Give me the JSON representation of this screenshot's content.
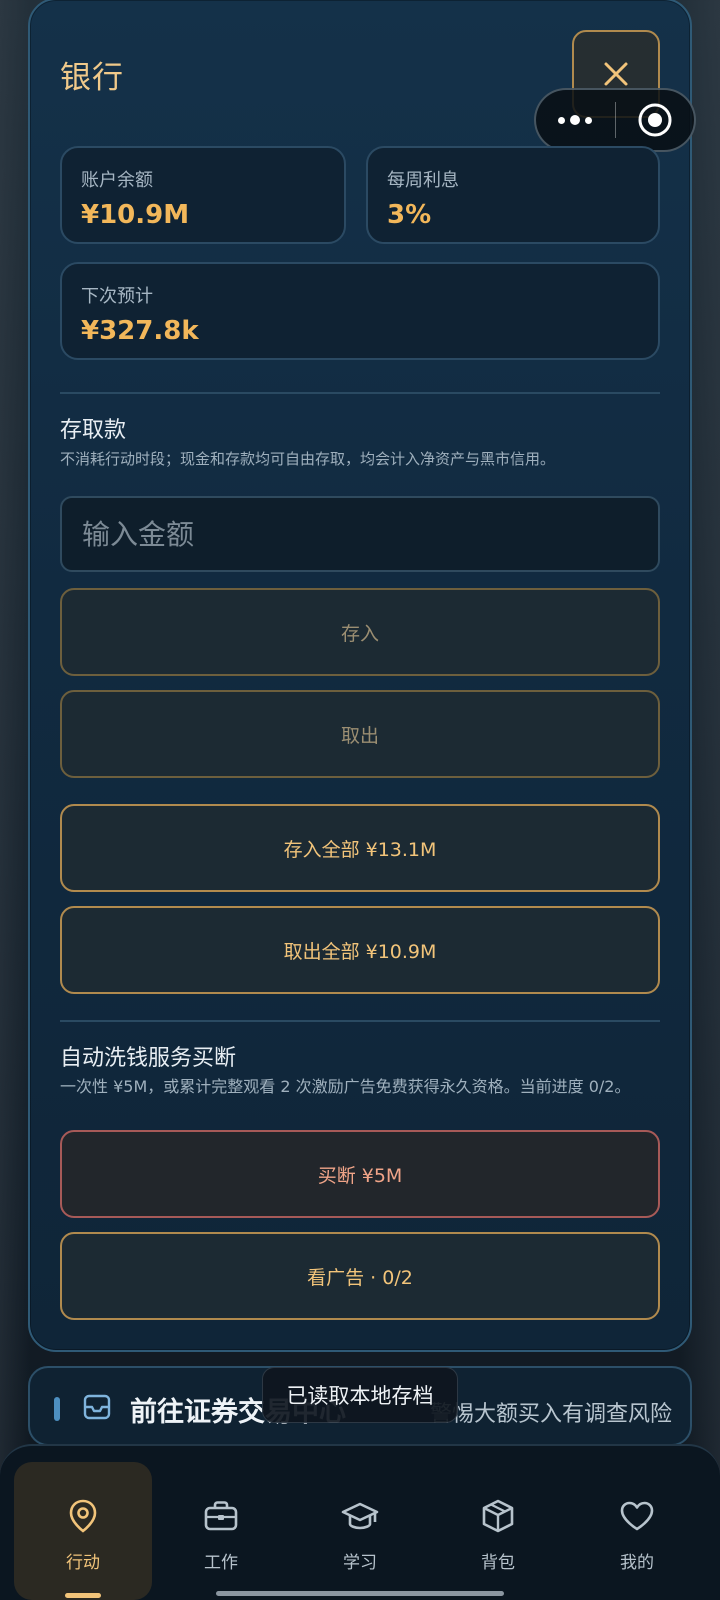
{
  "panel": {
    "title": "银行"
  },
  "stats": {
    "balance_label": "账户余额",
    "balance_value": "¥10.9M",
    "interest_label": "每周利息",
    "interest_value": "3%",
    "next_label": "下次预计",
    "next_value": "¥327.8k"
  },
  "deposit_section": {
    "title": "存取款",
    "desc": "不消耗行动时段；现金和存款均可自由存取，均会计入净资产与黑市信用。",
    "input_placeholder": "输入金额",
    "deposit_label": "存入",
    "withdraw_label": "取出",
    "deposit_all_label": "存入全部 ¥13.1M",
    "withdraw_all_label": "取出全部 ¥10.9M"
  },
  "laundering_section": {
    "title": "自动洗钱服务买断",
    "desc": "一次性 ¥5M，或累计完整观看 2 次激励广告免费获得永久资格。当前进度 0/2。",
    "buy_label": "买断 ¥5M",
    "watch_ad_label": "看广告 · 0/2"
  },
  "banner": {
    "title": "前往证券交易中心",
    "hint": "警惕大额买入有调查风险"
  },
  "toast": {
    "text": "已读取本地存档"
  },
  "tabbar": {
    "tabs": [
      {
        "label": "行动",
        "icon": "location-pin-icon",
        "active": true
      },
      {
        "label": "工作",
        "icon": "briefcase-icon",
        "active": false
      },
      {
        "label": "学习",
        "icon": "graduation-cap-icon",
        "active": false
      },
      {
        "label": "背包",
        "icon": "package-box-icon",
        "active": false
      },
      {
        "label": "我的",
        "icon": "heart-icon",
        "active": false
      }
    ]
  },
  "colors": {
    "accent_gold": "#f2b75a",
    "accent_red": "#a75a58"
  }
}
